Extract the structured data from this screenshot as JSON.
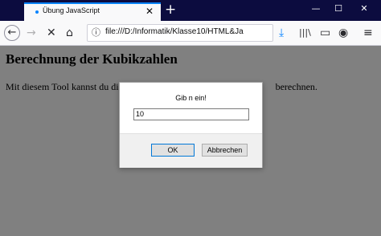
{
  "browser": {
    "tab_title": "Übung JavaScript",
    "tab_close": "✕",
    "new_tab": "+",
    "window_buttons": [
      "—",
      "☐",
      "✕"
    ],
    "url": "file:///D:/Informatik/Klasse10/HTML&Ja",
    "icons": {
      "back": "←",
      "forward": "→",
      "stop": "✕",
      "home": "⌂",
      "info": "ⓘ",
      "more": "···",
      "bookmark": "☆",
      "download": "⤓",
      "library": "|||\\",
      "sidebar": "▭",
      "account": "◉",
      "menu": "≡"
    }
  },
  "page": {
    "heading": "Berechnung der Kubikzahlen",
    "paragraph": "Mit diesem Tool kannst du di",
    "paragraph_end": "berechnen."
  },
  "dialog": {
    "prompt": "Gib n ein!",
    "input_value": "10",
    "ok_label": "OK",
    "cancel_label": "Abbrechen"
  }
}
